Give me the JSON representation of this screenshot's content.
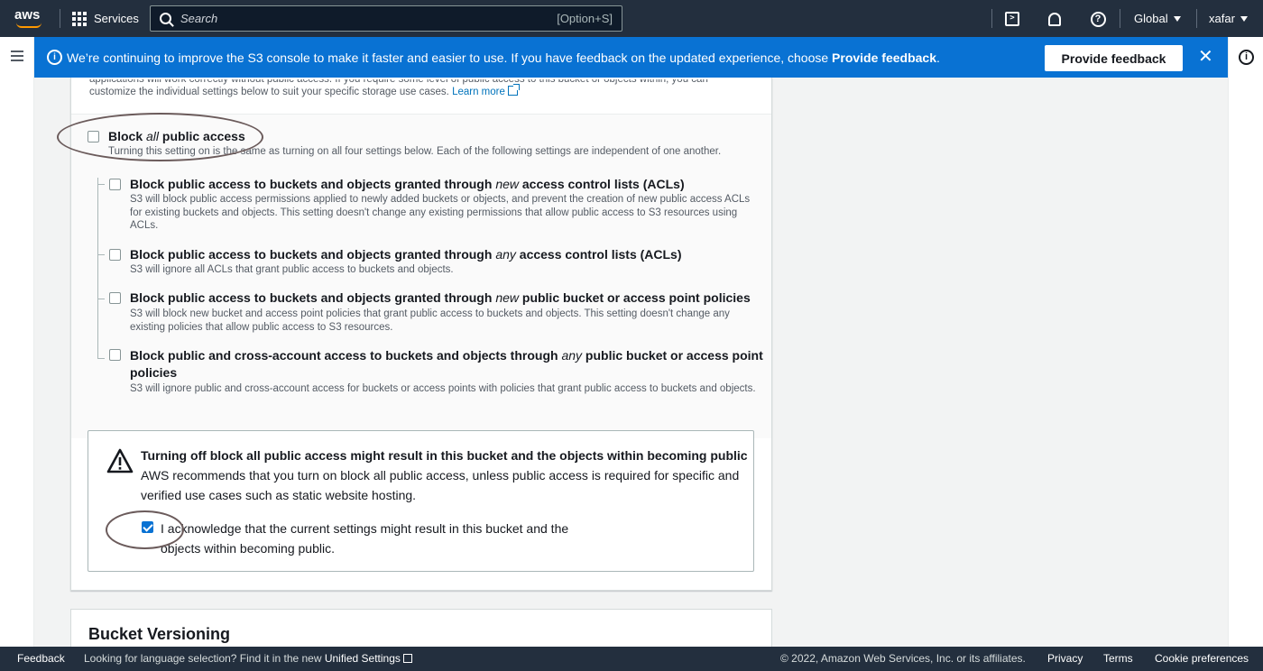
{
  "topnav": {
    "logo": "aws",
    "services_label": "Services",
    "search_placeholder": "Search",
    "search_shortcut": "[Option+S]",
    "region": "Global",
    "user": "xafar"
  },
  "banner": {
    "message": "We’re continuing to improve the S3 console to make it faster and easier to use. If you have feedback on the updated experience, choose ",
    "message_bold": "Provide feedback",
    "message_end": ".",
    "button": "Provide feedback",
    "close": "✕"
  },
  "intro": {
    "line_partial": "applications will work correctly without public access. If you require some level of public access to this bucket or objects within, you can",
    "line2": "customize the individual settings below to suit your specific storage use cases. ",
    "learn_more": "Learn more"
  },
  "block_all": {
    "title_pre": "Block ",
    "title_em": "all",
    "title_post": " public access",
    "description": "Turning this setting on is the same as turning on all four settings below. Each of the following settings are independent of one another.",
    "checked": false
  },
  "options": [
    {
      "title_pre": "Block public access to buckets and objects granted through ",
      "title_em": "new",
      "title_post": " access control lists (ACLs)",
      "description": "S3 will block public access permissions applied to newly added buckets or objects, and prevent the creation of new public access ACLs for existing buckets and objects. This setting doesn't change any existing permissions that allow public access to S3 resources using ACLs.",
      "checked": false
    },
    {
      "title_pre": "Block public access to buckets and objects granted through ",
      "title_em": "any",
      "title_post": " access control lists (ACLs)",
      "description": "S3 will ignore all ACLs that grant public access to buckets and objects.",
      "checked": false
    },
    {
      "title_pre": "Block public access to buckets and objects granted through ",
      "title_em": "new",
      "title_post": " public bucket or access point policies",
      "description": "S3 will block new bucket and access point policies that grant public access to buckets and objects. This setting doesn't change any existing policies that allow public access to S3 resources.",
      "checked": false
    },
    {
      "title_pre": "Block public and cross-account access to buckets and objects through ",
      "title_em": "any",
      "title_post": " public bucket or access point",
      "title_line2": "policies",
      "description": "S3 will ignore public and cross-account access for buckets or access points with policies that grant public access to buckets and objects.",
      "checked": false
    }
  ],
  "warning": {
    "title": "Turning off block all public access might result in this bucket and the objects within becoming public",
    "body": "AWS recommends that you turn on block all public access, unless public access is required for specific and verified use cases such as static website hosting.",
    "acknowledge": "I acknowledge that the current settings might result in this bucket and the objects within becoming public.",
    "acknowledge_checked": true
  },
  "versioning": {
    "heading": "Bucket Versioning"
  },
  "footer": {
    "feedback": "Feedback",
    "language_pre": "Looking for language selection? Find it in the new ",
    "unified_settings": "Unified Settings",
    "copyright": "© 2022, Amazon Web Services, Inc. or its affiliates.",
    "privacy": "Privacy",
    "terms": "Terms",
    "cookies": "Cookie preferences"
  },
  "colors": {
    "nav_bg": "#232f3e",
    "banner_bg": "#0972d3",
    "accent_orange": "#ff9900",
    "link": "#0073bb"
  }
}
